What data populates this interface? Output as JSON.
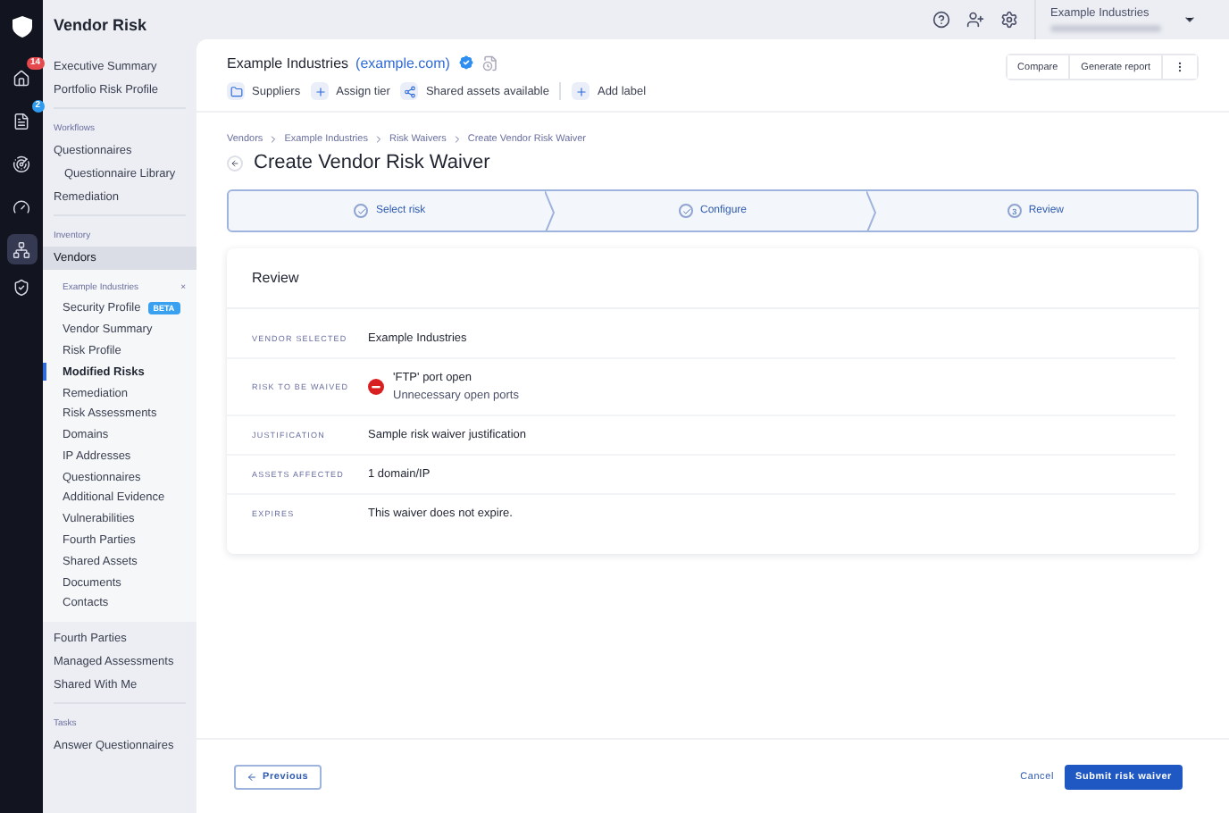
{
  "app": {
    "title": "Vendor Risk"
  },
  "rail": [
    {
      "kind": "home",
      "badge": "14",
      "color": "#e5484d",
      "selected": false
    },
    {
      "kind": "doc",
      "badge": "2",
      "color": "#2f9bf0",
      "selected": false
    },
    {
      "kind": "radar",
      "selected": false
    },
    {
      "kind": "gauge",
      "selected": false
    },
    {
      "kind": "network",
      "selected": true
    },
    {
      "kind": "shield",
      "selected": false
    }
  ],
  "sidebar": {
    "top_items": [
      {
        "label": "Executive Summary",
        "selected": false
      },
      {
        "label": "Portfolio Risk Profile",
        "selected": false
      }
    ],
    "sections": [
      {
        "heading": "Workflows",
        "items": [
          {
            "label": "Questionnaires",
            "selected": false,
            "children": [
              {
                "label": "Questionnaire Library",
                "selected": false
              }
            ]
          },
          {
            "label": "Remediation",
            "selected": false
          }
        ]
      },
      {
        "heading": "Inventory",
        "items": [
          {
            "label": "Vendors",
            "selected": true
          }
        ]
      }
    ],
    "vendor_nav": {
      "title": "Example Industries",
      "close": "×",
      "items": [
        {
          "label": "Security Profile",
          "tag": "BETA",
          "selected": false
        },
        {
          "label": "Vendor Summary",
          "selected": false
        },
        {
          "label": "Risk Profile",
          "selected": false
        },
        {
          "label": "Modified Risks",
          "selected": true
        },
        {
          "label": "Remediation",
          "selected": false
        },
        {
          "label": "Risk Assessments",
          "selected": false
        },
        {
          "label": "Domains",
          "selected": false
        },
        {
          "label": "IP Addresses",
          "selected": false
        },
        {
          "label": "Questionnaires",
          "selected": false
        },
        {
          "label": "Additional Evidence",
          "selected": false
        },
        {
          "label": "Vulnerabilities",
          "selected": false
        },
        {
          "label": "Fourth Parties",
          "selected": false
        },
        {
          "label": "Shared Assets",
          "selected": false
        },
        {
          "label": "Documents",
          "selected": false
        },
        {
          "label": "Contacts",
          "selected": false
        }
      ]
    },
    "after_items": [
      {
        "label": "Fourth Parties",
        "selected": false
      },
      {
        "label": "Managed Assessments",
        "selected": false
      },
      {
        "label": "Shared With Me",
        "selected": false
      }
    ],
    "tasks": {
      "heading": "Tasks",
      "items": [
        {
          "label": "Answer Questionnaires",
          "selected": false
        }
      ]
    }
  },
  "account": {
    "name": "Example Industries"
  },
  "vendor": {
    "name": "Example Industries",
    "domain": "(example.com)",
    "verified": true,
    "tags": [
      {
        "kind": "folder",
        "label": "Suppliers"
      },
      {
        "kind": "plus",
        "label": "Assign tier"
      },
      {
        "kind": "share",
        "label": "Shared assets available"
      },
      {
        "kind": "plus",
        "label": "Add label"
      }
    ],
    "actions": [
      "Compare",
      "Generate report"
    ]
  },
  "breadcrumb": [
    "Vendors",
    "Example Industries",
    "Risk Waivers",
    "Create Vendor Risk Waiver"
  ],
  "page_title": "Create Vendor Risk Waiver",
  "steps": [
    {
      "label": "Select risk",
      "done": true
    },
    {
      "label": "Configure",
      "done": true
    },
    {
      "label": "Review",
      "done": false,
      "number": "3"
    }
  ],
  "review": {
    "title": "Review",
    "rows": [
      {
        "label": "VENDOR SELECTED",
        "kind": "text",
        "value": "Example Industries"
      },
      {
        "label": "RISK TO BE WAIVED",
        "kind": "risk",
        "value": "'FTP' port open",
        "detail": "Unnecessary open ports"
      },
      {
        "label": "JUSTIFICATION",
        "kind": "text",
        "value": "Sample risk waiver justification"
      },
      {
        "label": "ASSETS AFFECTED",
        "kind": "text",
        "value": "1 domain/IP"
      },
      {
        "label": "EXPIRES",
        "kind": "text",
        "value": "This waiver does not expire."
      }
    ]
  },
  "footer": {
    "previous": "Previous",
    "cancel": "Cancel",
    "submit": "Submit risk waiver"
  }
}
